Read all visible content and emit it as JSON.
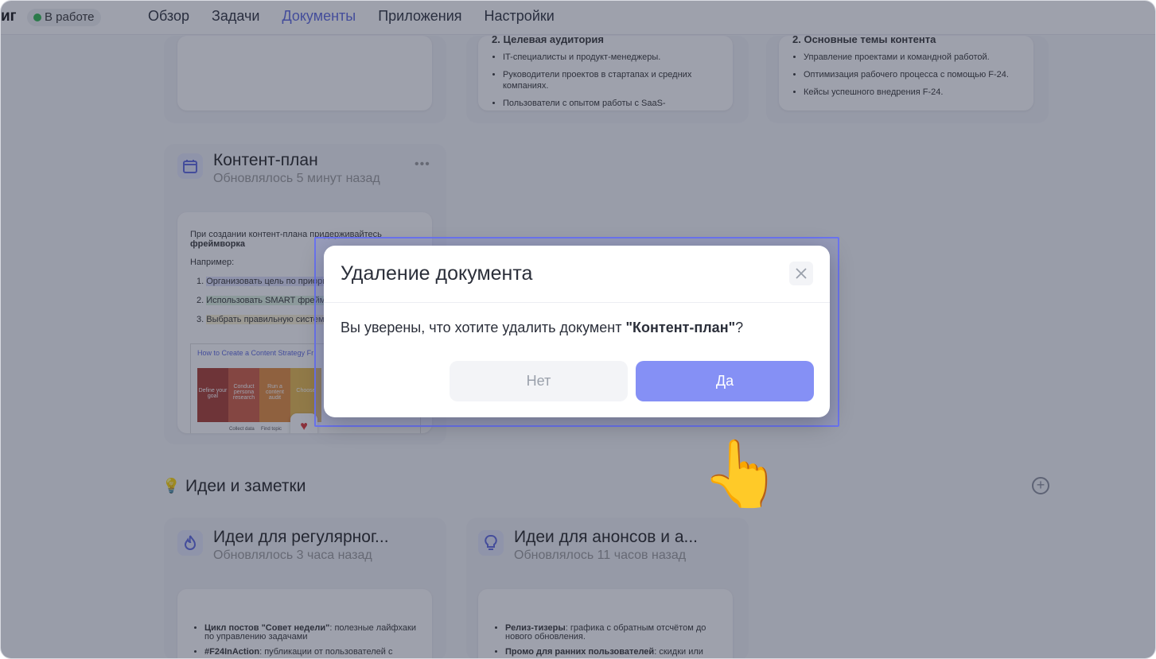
{
  "topbar": {
    "brand_fragment": "иг",
    "status_label": "В работе",
    "nav": [
      "Обзор",
      "Задачи",
      "Документы",
      "Приложения",
      "Настройки"
    ],
    "active_nav": "Документы"
  },
  "docs_top": {
    "audience_title": "2. Целевая аудитория",
    "audience_items": [
      "IT-специалисты и продукт-менеджеры.",
      "Руководители проектов в стартапах и средних компаниях.",
      "Пользователи с опытом работы с SaaS-"
    ],
    "themes_title": "2. Основные темы контента",
    "themes_items": [
      "Управление проектами и командной работой.",
      "Оптимизация рабочего процесса с помощью F-24.",
      "Кейсы успешного внедрения F-24."
    ]
  },
  "content_plan": {
    "title": "Контент-план",
    "updated": "Обновлялось 5 минут назад",
    "preview_intro": "При создании контент-плана придерживайтесь",
    "preview_bold": "фреймворка",
    "preview_example": "Например:",
    "preview_items": [
      "Организовать цель по приори",
      "Использовать SMART фрейм",
      "Выбрать правильную систем контентом"
    ],
    "preview_image_title": "How to Create a Content Strategy Fr",
    "preview_image_cells": [
      "Define your goal",
      "Conduct persona research",
      "Run a content audit",
      "Choose"
    ],
    "preview_image_footer": [
      "Collect data",
      "Find topic"
    ]
  },
  "ideas_section": {
    "title": "Идеи и заметки",
    "card1_title": "Идеи для регулярног...",
    "card1_updated": "Обновлялось 3 часа назад",
    "card1_item1_bold": "Цикл постов \"Совет недели\"",
    "card1_item1_rest": ": полезные лайфхаки по управлению задачами",
    "card1_item2_bold": "#F24InAction",
    "card1_item2_rest": ": публикации от пользователей с",
    "card2_title": "Идеи для анонсов и а...",
    "card2_updated": "Обновлялось 11 часов назад",
    "card2_item1_bold": "Релиз-тизеры",
    "card2_item1_rest": ": графика с обратным отсчётом до нового обновления.",
    "card2_item2_bold": "Промо для ранних пользователей",
    "card2_item2_rest": ": скидки или"
  },
  "modal": {
    "title": "Удаление документа",
    "text_before": "Вы уверены, что хотите удалить документ ",
    "doc_name": "\"Контент-план\"",
    "text_after": "?",
    "no_label": "Нет",
    "yes_label": "Да"
  },
  "colors": {
    "accent": "#5b67e0",
    "yes_button": "#8590f5",
    "overlay": "#282e46",
    "status_dot": "#2fb84d"
  },
  "cursor_emoji": "👆"
}
